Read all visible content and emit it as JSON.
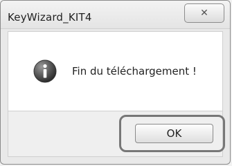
{
  "window": {
    "title": "KeyWizard_KIT4",
    "close_icon": "close-icon"
  },
  "dialog": {
    "icon": "information-icon",
    "message": "Fin du téléchargement !"
  },
  "buttons": {
    "ok_label": "OK"
  },
  "colors": {
    "window_bg": "#e9e9e9",
    "content_bg": "#ffffff",
    "icon_dark": "#4a4a4a",
    "highlight_border": "#777777"
  }
}
